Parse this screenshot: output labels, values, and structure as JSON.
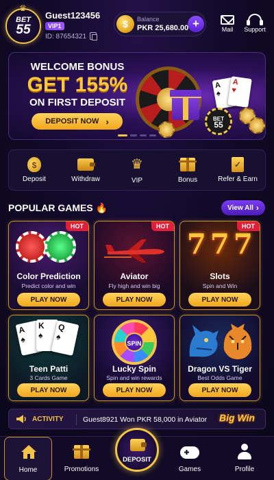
{
  "header": {
    "logo": {
      "line1": "BET",
      "line2": "55"
    },
    "username": "Guest123456",
    "vip_badge": "VIP1",
    "user_id": "ID: 87654321",
    "balance_label": "Balance",
    "balance_value": "PKR 25,680.00",
    "mail_label": "Mail",
    "support_label": "Support"
  },
  "banner": {
    "line1": "WELCOME BONUS",
    "line2": "GET 155%",
    "line3": "ON FIRST DEPOSIT",
    "cta": "DEPOSIT NOW",
    "chip_logo": {
      "line1": "BET",
      "line2": "55"
    },
    "slide_count": 4,
    "active_slide": 1
  },
  "quick_actions": [
    {
      "label": "Deposit",
      "icon": "money-bag-icon"
    },
    {
      "label": "Withdraw",
      "icon": "wallet-icon"
    },
    {
      "label": "VIP",
      "icon": "crown-icon"
    },
    {
      "label": "Bonus",
      "icon": "gift-icon"
    },
    {
      "label": "Refer & Earn",
      "icon": "clipboard-icon"
    }
  ],
  "popular": {
    "title": "POPULAR GAMES",
    "view_all": "View All",
    "play_label": "PLAY NOW",
    "hot_label": "HOT",
    "games": [
      {
        "title": "Color Prediction",
        "subtitle": "Predict color and win",
        "hot": true
      },
      {
        "title": "Aviator",
        "subtitle": "Fly high and win big",
        "hot": true
      },
      {
        "title": "Slots",
        "subtitle": "Spin and Win",
        "hot": true
      },
      {
        "title": "Teen Patti",
        "subtitle": "3 Cards Game",
        "hot": false
      },
      {
        "title": "Lucky Spin",
        "subtitle": "Spin and win rewards",
        "hot": false
      },
      {
        "title": "Dragon VS Tiger",
        "subtitle": "Best Odds Game",
        "hot": false
      }
    ],
    "wheel_label": "SPIN"
  },
  "activity": {
    "label": "ACTIVITY",
    "text": "Guest8921 Won PKR 58,000 in Aviator",
    "badge": "Big Win"
  },
  "bottom_nav": {
    "home": "Home",
    "promotions": "Promotions",
    "deposit": "DEPOSIT",
    "games": "Games",
    "profile": "Profile"
  },
  "colors": {
    "accent_gold": "#f3c44a",
    "accent_purple": "#7a3df2",
    "hot_red": "#e0203a",
    "background": "#0d0820"
  }
}
